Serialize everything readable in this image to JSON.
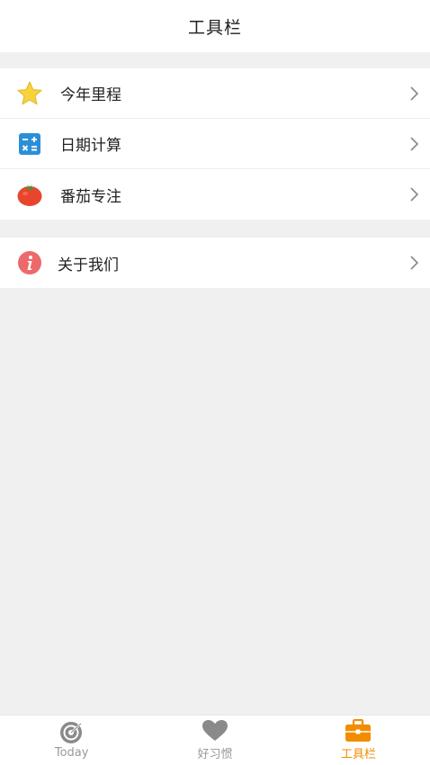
{
  "header": {
    "title": "工具栏"
  },
  "groups": [
    {
      "items": [
        {
          "label": "今年里程",
          "icon": "star-icon"
        },
        {
          "label": "日期计算",
          "icon": "calculator-icon"
        },
        {
          "label": "番茄专注",
          "icon": "tomato-icon"
        }
      ]
    },
    {
      "items": [
        {
          "label": "关于我们",
          "icon": "info-icon"
        }
      ]
    }
  ],
  "tabbar": {
    "tabs": [
      {
        "label": "Today",
        "icon": "target-icon",
        "active": false
      },
      {
        "label": "好习惯",
        "icon": "heart-icon",
        "active": false
      },
      {
        "label": "工具栏",
        "icon": "toolbox-icon",
        "active": true
      }
    ]
  },
  "colors": {
    "accent": "#f28c00",
    "inactive_tab": "#999999",
    "background": "#f0f0f0"
  }
}
